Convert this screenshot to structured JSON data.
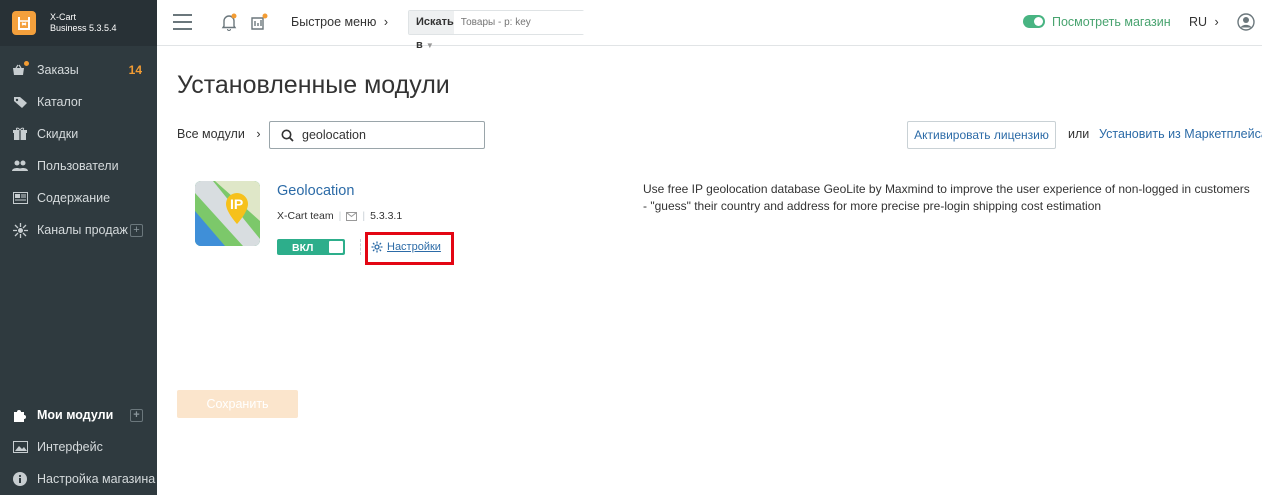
{
  "brand": {
    "line1": "X-Cart",
    "line2": "Business 5.3.5.4"
  },
  "sidebar": {
    "items": [
      {
        "label": "Заказы",
        "count": "14"
      },
      {
        "label": "Каталог"
      },
      {
        "label": "Скидки"
      },
      {
        "label": "Пользователи"
      },
      {
        "label": "Содержание"
      },
      {
        "label": "Каналы продаж"
      }
    ],
    "bottom_items": [
      {
        "label": "Мои модули"
      },
      {
        "label": "Интерфейс"
      },
      {
        "label": "Настройка магазина"
      }
    ]
  },
  "topbar": {
    "quick_menu": "Быстрое меню",
    "search_in_label": "Искать в",
    "search_placeholder": "Товары - p: key",
    "store_link": "Посмотреть магазин",
    "language": "RU"
  },
  "main": {
    "title": "Установленные модули",
    "breadcrumb": "Все модули",
    "filter_value": "geolocation",
    "activate_license": "Активировать лицензию",
    "or_text": "или",
    "marketplace_link": "Установить из Маркетплейса",
    "save_button": "Сохранить"
  },
  "module": {
    "name": "Geolocation",
    "author": "X-Cart team",
    "version": "5.3.3.1",
    "state_label": "ВКЛ",
    "settings_label": "Настройки",
    "icon_text": "IP",
    "description": "Use free IP geolocation database GeoLite by Maxmind to improve the user experience of non-logged in customers - \"guess\" their country and address for more precise pre-login shipping cost estimation"
  },
  "colors": {
    "sidebar_bg": "#2f3a3f",
    "accent_orange": "#f39c33",
    "link_blue": "#2c6ba7",
    "toggle_green": "#2dae8b",
    "highlight_red": "#e30613"
  }
}
